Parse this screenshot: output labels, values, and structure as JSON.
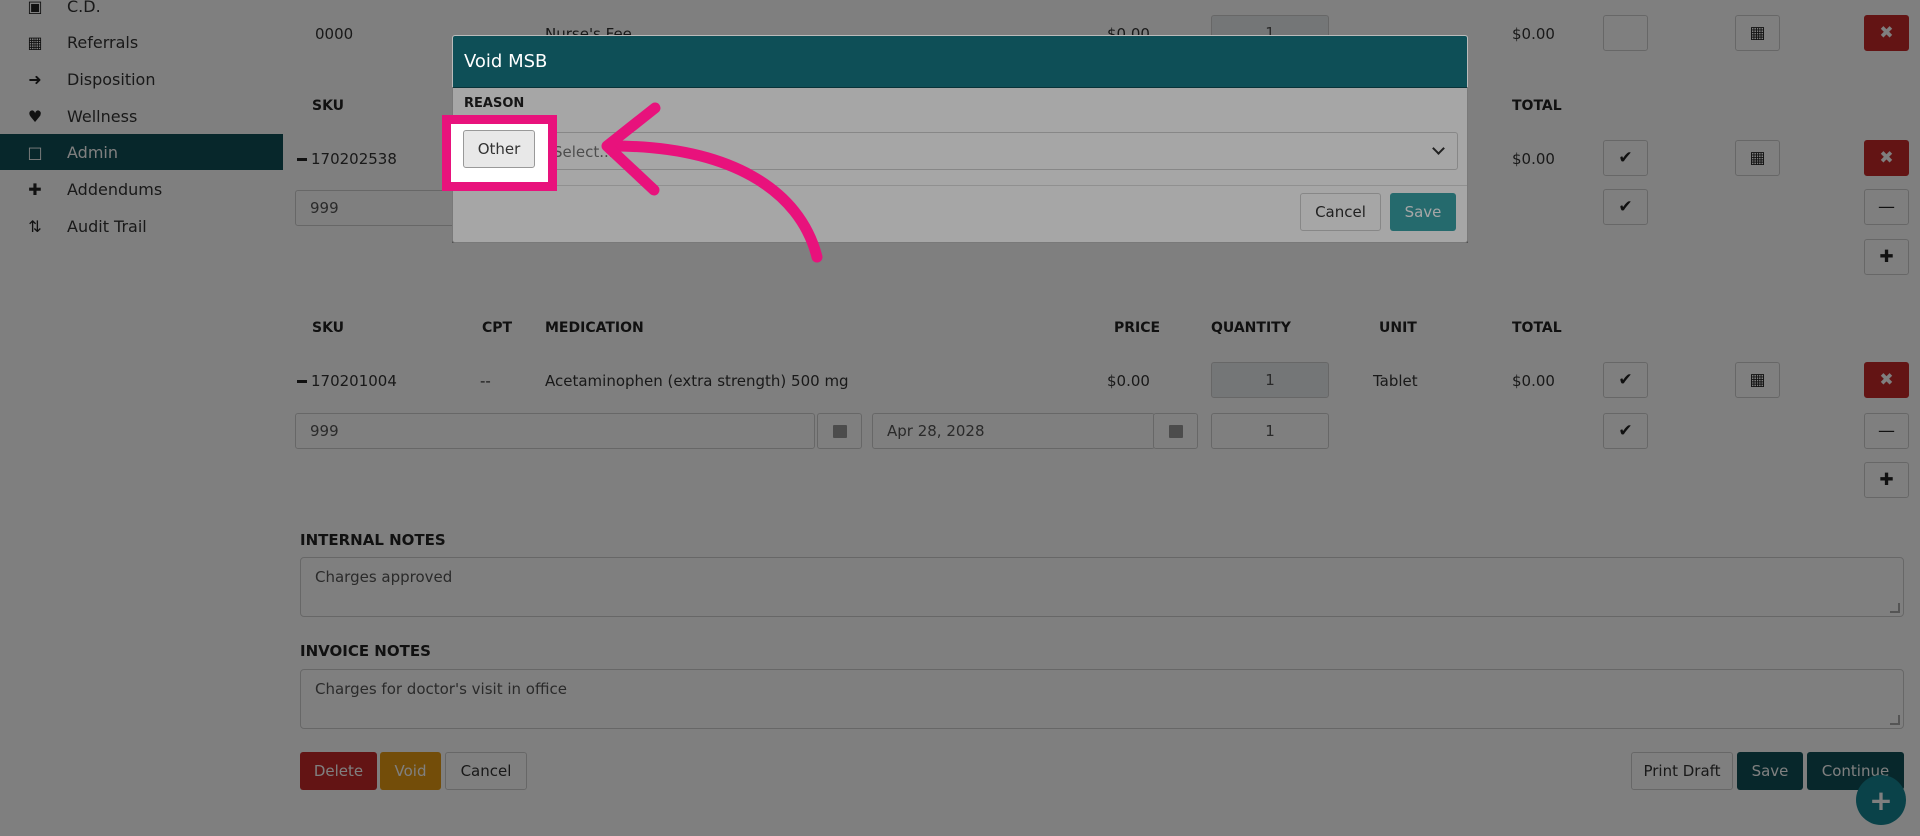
{
  "sidebar": {
    "items": [
      {
        "label": "C.D.",
        "icon": "briefcase-icon"
      },
      {
        "label": "Referrals",
        "icon": "referral-icon"
      },
      {
        "label": "Disposition",
        "icon": "sign-out-icon"
      },
      {
        "label": "Wellness",
        "icon": "heartbeat-icon"
      },
      {
        "label": "Admin",
        "icon": "document-icon"
      },
      {
        "label": "Addendums",
        "icon": "plus-icon"
      },
      {
        "label": "Audit Trail",
        "icon": "sort-list-icon"
      }
    ],
    "active": "Admin"
  },
  "row0": {
    "sku": "0000",
    "medication": "Nurse's Fee",
    "price": "$0.00",
    "quantity": "1",
    "total": "$0.00"
  },
  "section1": {
    "headers": {
      "sku": "SKU",
      "total": "TOTAL"
    },
    "sku": "170202538",
    "total": "$0.00",
    "lot": "999"
  },
  "section2": {
    "headers": {
      "sku": "SKU",
      "cpt": "CPT",
      "medication": "MEDICATION",
      "price": "PRICE",
      "quantity": "QUANTITY",
      "unit": "UNIT",
      "total": "TOTAL"
    },
    "sku": "170201004",
    "cpt": "--",
    "medication": "Acetaminophen (extra strength) 500 mg",
    "price": "$0.00",
    "quantity": "1",
    "unit": "Tablet",
    "total": "$0.00",
    "lot": "999",
    "expiry": "Apr 28, 2028",
    "lot_quantity": "1"
  },
  "notes": {
    "internal_label": "INTERNAL NOTES",
    "internal_value": "Charges approved",
    "invoice_label": "INVOICE NOTES",
    "invoice_value": "Charges for doctor's visit in office"
  },
  "actions": {
    "delete": "Delete",
    "void": "Void",
    "cancel": "Cancel",
    "print_draft": "Print Draft",
    "save": "Save",
    "continue": "Continue"
  },
  "modal": {
    "title": "Void MSB",
    "reason_label": "REASON",
    "select_placeholder": "Select...",
    "cancel": "Cancel",
    "save": "Save",
    "dropdown_option": "Other"
  },
  "colors": {
    "teal": "#0e4f57",
    "danger": "#c62828",
    "warning": "#e69a12",
    "highlight": "#e8127c",
    "fab": "#158592"
  }
}
